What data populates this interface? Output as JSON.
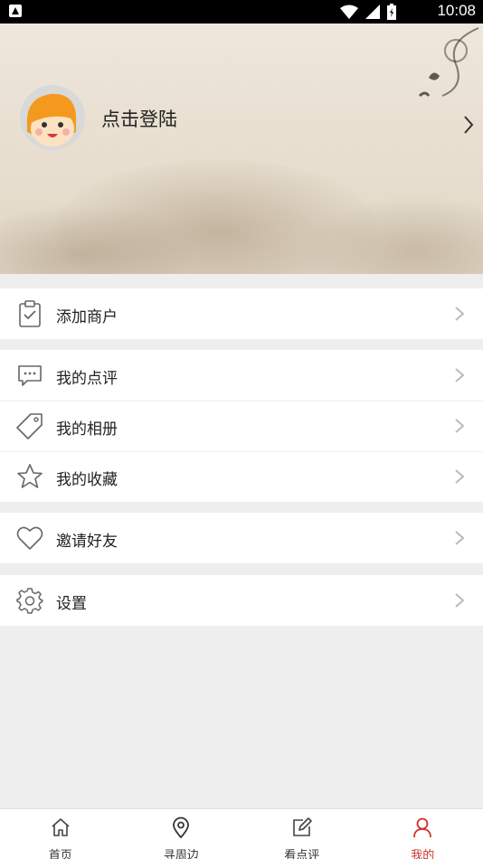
{
  "status_bar": {
    "time": "10:08"
  },
  "header": {
    "login_text": "点击登陆"
  },
  "menu_groups": [
    {
      "items": [
        {
          "label": "添加商户",
          "icon": "clipboard-check-icon"
        }
      ]
    },
    {
      "items": [
        {
          "label": "我的点评",
          "icon": "comment-icon"
        },
        {
          "label": "我的相册",
          "icon": "tag-icon"
        },
        {
          "label": "我的收藏",
          "icon": "star-icon"
        }
      ]
    },
    {
      "items": [
        {
          "label": "邀请好友",
          "icon": "heart-icon"
        }
      ]
    },
    {
      "items": [
        {
          "label": "设置",
          "icon": "gear-icon"
        }
      ]
    }
  ],
  "tabbar": {
    "tabs": [
      {
        "label": "首页",
        "icon": "home-icon",
        "active": false
      },
      {
        "label": "寻周边",
        "icon": "location-pin-icon",
        "active": false
      },
      {
        "label": "看点评",
        "icon": "edit-icon",
        "active": false
      },
      {
        "label": "我的",
        "icon": "user-icon",
        "active": true
      }
    ],
    "active_color": "#d0312d"
  }
}
